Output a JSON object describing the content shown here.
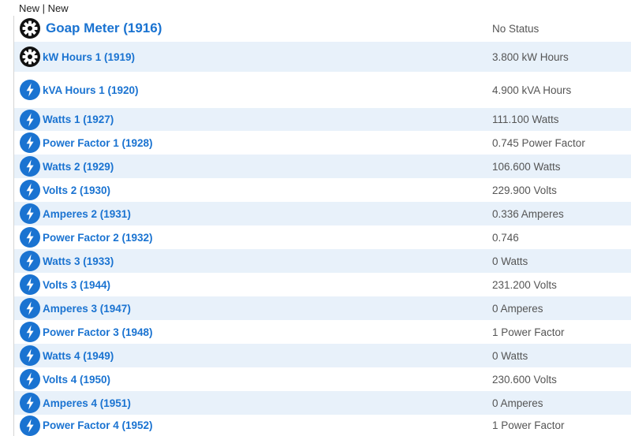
{
  "breadcrumb": "New | New",
  "colors": {
    "link": "#1a73d1",
    "row_alt": "#e8f1fa",
    "gear_icon_bg": "#111111",
    "bolt_icon_bg": "#1a73d1"
  },
  "header": {
    "title": "Goap Meter  (1916)",
    "status": "No Status",
    "icon": "gear-icon"
  },
  "rows": [
    {
      "label": "kW Hours 1 (1919)",
      "value": "3.800 kW Hours",
      "icon": "gear-icon"
    },
    {
      "label": "kVA Hours 1 (1920)",
      "value": "4.900 kVA Hours",
      "icon": "lightning-icon"
    },
    {
      "label": "Watts 1 (1927)",
      "value": "111.100 Watts",
      "icon": "lightning-icon"
    },
    {
      "label": "Power Factor 1 (1928)",
      "value": "0.745 Power Factor",
      "icon": "lightning-icon"
    },
    {
      "label": "Watts 2 (1929)",
      "value": "106.600 Watts",
      "icon": "lightning-icon"
    },
    {
      "label": "Volts 2 (1930)",
      "value": "229.900 Volts",
      "icon": "lightning-icon"
    },
    {
      "label": "Amperes 2 (1931)",
      "value": "0.336 Amperes",
      "icon": "lightning-icon"
    },
    {
      "label": "Power Factor 2 (1932)",
      "value": "0.746",
      "icon": "lightning-icon"
    },
    {
      "label": "Watts 3 (1933)",
      "value": "0 Watts",
      "icon": "lightning-icon"
    },
    {
      "label": "Volts 3 (1944)",
      "value": "231.200 Volts",
      "icon": "lightning-icon"
    },
    {
      "label": "Amperes 3 (1947)",
      "value": "0 Amperes",
      "icon": "lightning-icon"
    },
    {
      "label": "Power Factor 3 (1948)",
      "value": "1 Power Factor",
      "icon": "lightning-icon"
    },
    {
      "label": "Watts 4 (1949)",
      "value": "0 Watts",
      "icon": "lightning-icon"
    },
    {
      "label": "Volts 4 (1950)",
      "value": "230.600 Volts",
      "icon": "lightning-icon"
    },
    {
      "label": "Amperes 4 (1951)",
      "value": "0 Amperes",
      "icon": "lightning-icon"
    },
    {
      "label": "Power Factor 4 (1952)",
      "value": "1 Power Factor",
      "icon": "lightning-icon"
    }
  ]
}
